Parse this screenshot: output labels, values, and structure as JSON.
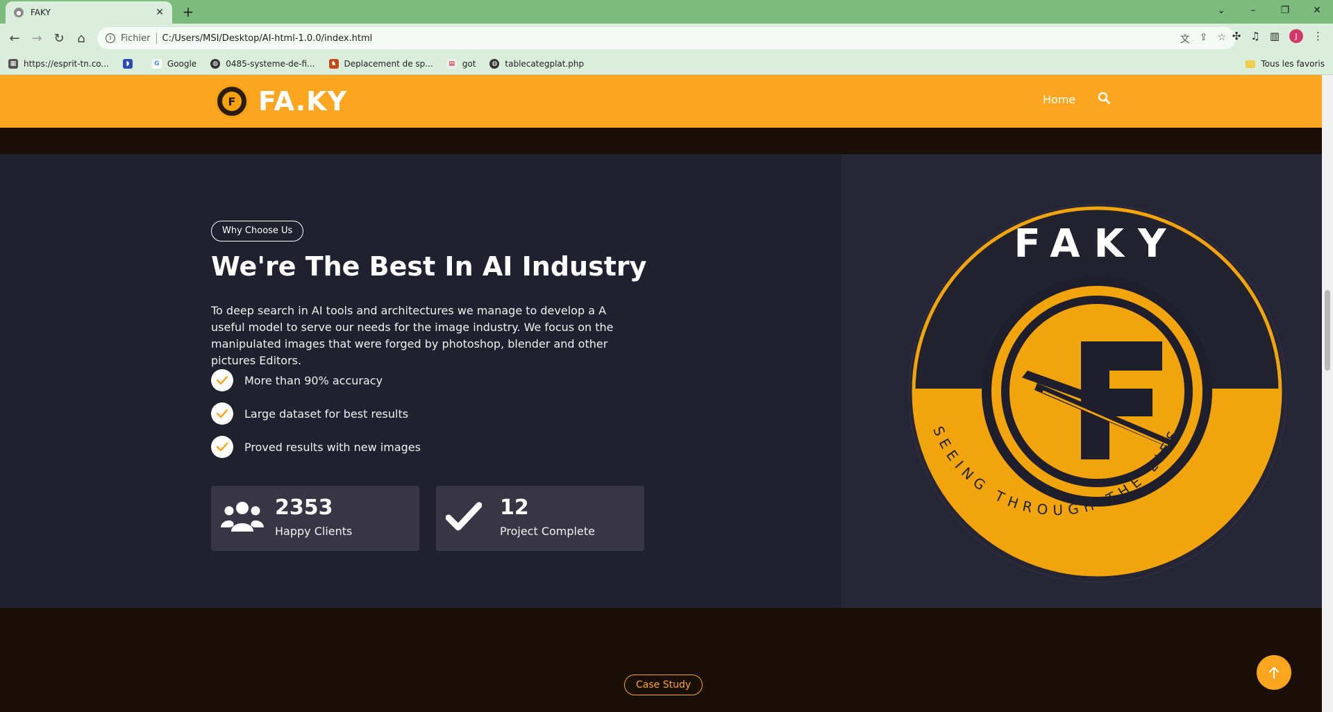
{
  "browser": {
    "tab_title": "FAKY",
    "url_scheme": "Fichier",
    "url": "C:/Users/MSI/Desktop/AI-html-1.0.0/index.html",
    "bookmarks": [
      {
        "label": "https://esprit-tn.co...",
        "icon": "grid-icon"
      },
      {
        "label": "",
        "icon": "app-icon"
      },
      {
        "label": "Google",
        "icon": "google-icon"
      },
      {
        "label": "0485-systeme-de-fi...",
        "icon": "globe-icon"
      },
      {
        "label": "Deplacement de sp...",
        "icon": "person-icon"
      },
      {
        "label": "got",
        "icon": "page-icon"
      },
      {
        "label": "tablecategplat.php",
        "icon": "globe-icon"
      }
    ],
    "other_bookmarks": "Tous les favoris",
    "profile_initial": "J"
  },
  "site": {
    "brand": "FA.KY",
    "nav": {
      "home": "Home"
    },
    "accent_color": "#fca61f"
  },
  "about": {
    "pill": "Why Choose Us",
    "heading": "We're The Best In AI Industry",
    "paragraph": "To deep search in AI tools and architectures we manage to develop a A useful model to serve our needs for the image industry. We focus on the manipulated images that were forged by photoshop, blender and other pictures Editors.",
    "features": [
      "More than 90% accuracy",
      "Large dataset for best results",
      "Proved results with new images"
    ],
    "stats": [
      {
        "value": "2353",
        "label": "Happy Clients",
        "icon": "users-icon"
      },
      {
        "value": "12",
        "label": "Project Complete",
        "icon": "check-icon"
      }
    ],
    "emblem": {
      "top_text": "FAKY",
      "bottom_text": "SEEING THROUGH THE LIES"
    }
  },
  "case_study": {
    "pill": "Case Study"
  }
}
